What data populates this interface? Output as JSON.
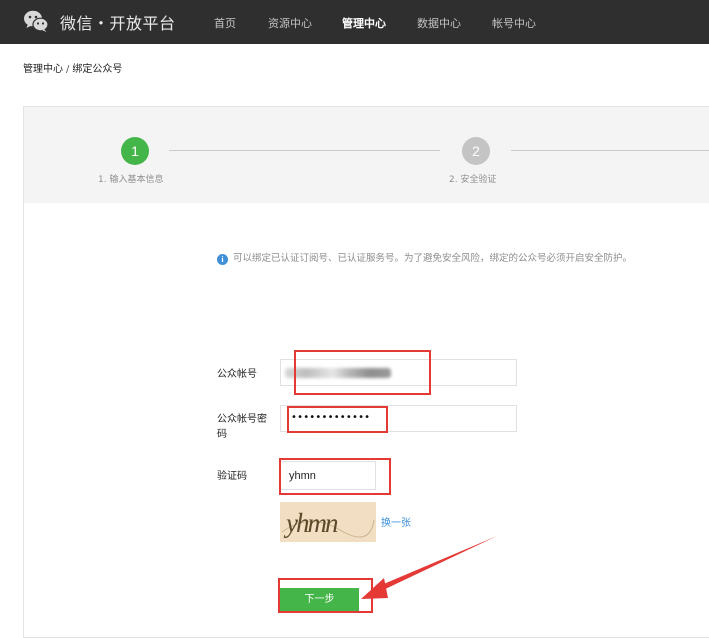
{
  "header": {
    "brand": "微信・开放平台",
    "nav": [
      {
        "label": "首页",
        "active": false
      },
      {
        "label": "资源中心",
        "active": false
      },
      {
        "label": "管理中心",
        "active": true
      },
      {
        "label": "数据中心",
        "active": false
      },
      {
        "label": "帐号中心",
        "active": false
      }
    ]
  },
  "breadcrumb": {
    "parent": "管理中心",
    "separator": "/",
    "current": "绑定公众号"
  },
  "steps": [
    {
      "number": "1",
      "label": "1. 输入基本信息",
      "state": "done"
    },
    {
      "number": "2",
      "label": "2. 安全验证",
      "state": "todo"
    }
  ],
  "notice": "可以绑定已认证订阅号、已认证服务号。为了避免安全风险，绑定的公众号必须开启安全防护。",
  "form": {
    "account_label": "公众帐号",
    "password_label": "公众帐号密码",
    "password_value": "•••••••••••••",
    "captcha_label": "验证码",
    "captcha_value": "yhmn",
    "captcha_image_text": "yhmn",
    "captcha_refresh": "换一张",
    "next_button": "下一步"
  },
  "colors": {
    "topbar": "#2f2f2f",
    "accent_green": "#44b549",
    "link_blue": "#3f8fd9",
    "highlight_red": "#e53935"
  }
}
